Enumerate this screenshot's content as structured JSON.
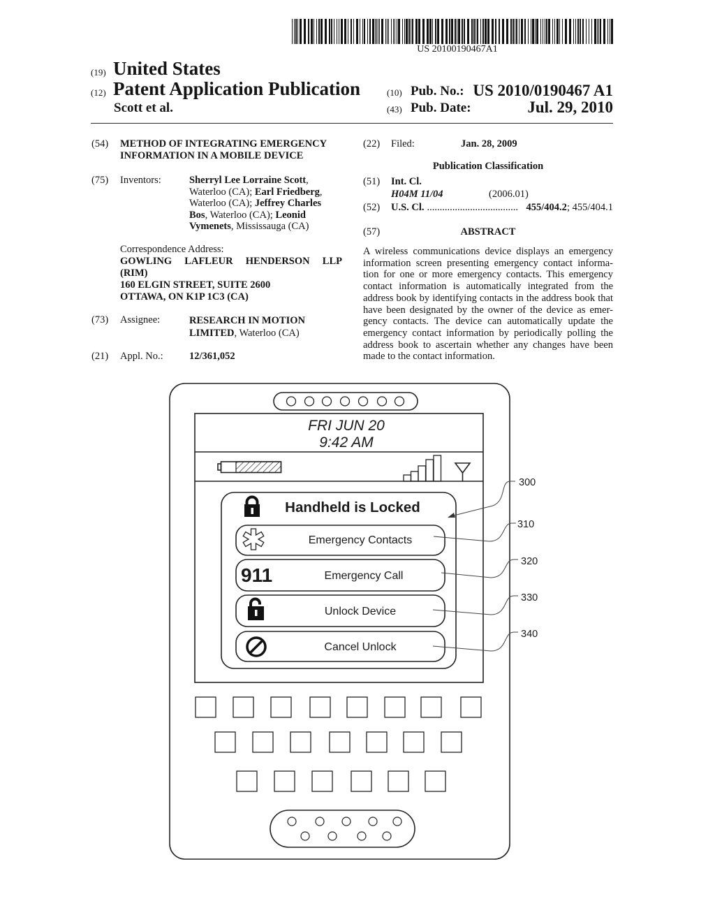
{
  "header": {
    "barcode_number": "US 20100190467A1",
    "country_code": "(19)",
    "country": "United States",
    "pub_type_code": "(12)",
    "pub_type": "Patent Application Publication",
    "authors": "Scott et al.",
    "pub_no_code": "(10)",
    "pub_no_label": "Pub. No.:",
    "pub_no": "US 2010/0190467 A1",
    "pub_date_code": "(43)",
    "pub_date_label": "Pub. Date:",
    "pub_date": "Jul. 29, 2010"
  },
  "left_column": {
    "title": {
      "code": "(54)",
      "lines": [
        "METHOD OF INTEGRATING EMERGENCY",
        "INFORMATION IN A MOBILE DEVICE"
      ]
    },
    "inventors": {
      "code": "(75)",
      "label": "Inventors:",
      "lines": [
        [
          "Sherryl Lee Lorraine Scott",
          ","
        ],
        [
          "Waterloo (CA); ",
          "Earl Friedberg",
          ","
        ],
        [
          "Waterloo (CA); ",
          "Jeffrey Charles"
        ],
        [
          "Bos",
          ", Waterloo (CA); ",
          "Leonid"
        ],
        [
          "Vymenets",
          ", Mississauga (CA)"
        ]
      ]
    },
    "correspondence": {
      "label": "Correspondence Address:",
      "lines": [
        "GOWLING LAFLEUR HENDERSON LLP",
        "(RIM)",
        "160 ELGIN STREET, SUITE 2600",
        "OTTAWA, ON K1P 1C3 (CA)"
      ]
    },
    "assignee": {
      "code": "(73)",
      "label": "Assignee:",
      "line1": "RESEARCH IN MOTION",
      "line2_bold": "LIMITED",
      "line2_rest": ", Waterloo (CA)"
    },
    "appl": {
      "code": "(21)",
      "label": "Appl. No.:",
      "value": "12/361,052"
    }
  },
  "right_column": {
    "filed": {
      "code": "(22)",
      "label": "Filed:",
      "value": "Jan. 28, 2009"
    },
    "classification_heading": "Publication Classification",
    "int_cl": {
      "code": "(51)",
      "label": "Int. Cl.",
      "class": "H04M 11/04",
      "version": "(2006.01)"
    },
    "us_cl": {
      "code": "(52)",
      "label": "U.S. Cl.",
      "dots": "....................................",
      "primary": "455/404.2",
      "secondary": "; 455/404.1"
    },
    "abstract": {
      "code": "(57)",
      "heading": "ABSTRACT",
      "lines": [
        "A wireless communications device displays an emergency",
        "information screen presenting emergency contact informa-",
        "tion for one or more emergency contacts. This emergency",
        "contact information is automatically integrated from the",
        "address book by identifying contacts in the address book that",
        "have been designated by the owner of the device as emer-",
        "gency contacts. The device can automatically update the",
        "emergency contact information by periodically polling the",
        "address book to ascertain whether any changes have been",
        "made to the contact information."
      ]
    }
  },
  "figure": {
    "screen": {
      "date": "FRI JUN 20",
      "time": "9:42 AM",
      "battery_level": 0.75,
      "signal_bars": 5
    },
    "dialog": {
      "title": "Handheld is Locked",
      "title_icon": "lock-icon",
      "buttons": [
        {
          "icon": "star-of-life-icon",
          "label": "Emergency Contacts"
        },
        {
          "icon_text": "911",
          "label": "Emergency Call"
        },
        {
          "icon": "unlock-icon",
          "label": "Unlock Device"
        },
        {
          "icon": "cancel-icon",
          "label": "Cancel Unlock"
        }
      ]
    },
    "callouts": [
      "300",
      "310",
      "320",
      "330",
      "340"
    ]
  }
}
